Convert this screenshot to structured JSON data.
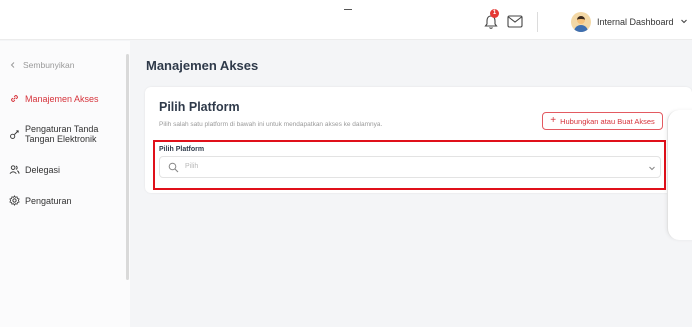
{
  "header": {
    "notification_count": "1",
    "user_name": "Internal Dashboard"
  },
  "sidebar": {
    "hide_label": "Sembunyikan",
    "items": [
      {
        "label": "Manajemen Akses",
        "icon": "link-icon",
        "active": true
      },
      {
        "label_line1": "Pengaturan Tanda",
        "label_line2": "Tangan Elektronik",
        "icon": "signature-icon"
      },
      {
        "label": "Delegasi",
        "icon": "users-icon"
      },
      {
        "label": "Pengaturan",
        "icon": "gear-icon"
      }
    ]
  },
  "main": {
    "page_title": "Manajemen Akses",
    "card": {
      "title": "Pilih Platform",
      "description": "Pilih salah satu platform di bawah ini untuk mendapatkan akses ke dalamnya.",
      "connect_button": "Hubungkan atau Buat Akses",
      "field_label": "Pilih Platform",
      "select_placeholder": "Pilih"
    }
  },
  "colors": {
    "accent": "#d6343c",
    "highlight": "#e0101a",
    "badge": "#e53935"
  }
}
